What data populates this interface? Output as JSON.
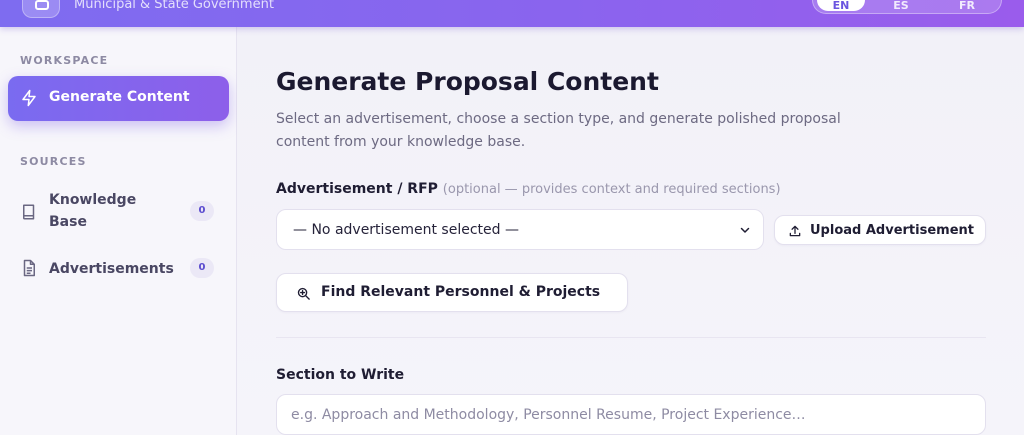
{
  "header": {
    "subtitle": "Municipal & State Government",
    "language_options": [
      "EN",
      "ES",
      "FR"
    ]
  },
  "sidebar": {
    "workspace_label": "WORKSPACE",
    "sources_label": "SOURCES",
    "items": [
      {
        "label": "Generate Content",
        "icon": "lightning-icon",
        "active": true
      },
      {
        "label": "Knowledge Base",
        "icon": "book-icon",
        "count": "0"
      },
      {
        "label": "Advertisements",
        "icon": "document-icon",
        "count": "0"
      }
    ]
  },
  "main": {
    "title": "Generate Proposal Content",
    "description": "Select an advertisement, choose a section type, and generate polished proposal content from your knowledge base.",
    "advertisement_label": "Advertisement / RFP",
    "advertisement_hint": "(optional — provides context and required sections)",
    "advertisement_select_value": "— No advertisement selected —",
    "upload_button_label": "Upload Advertisement",
    "find_button_label": "Find Relevant Personnel & Projects",
    "section_label": "Section to Write",
    "section_placeholder": "e.g. Approach and Methodology, Personnel Resume, Project Experience…"
  },
  "colors": {
    "accent": "#7a6bf0",
    "accent_end": "#8d5fea",
    "badge_text": "#5b4ccf"
  }
}
